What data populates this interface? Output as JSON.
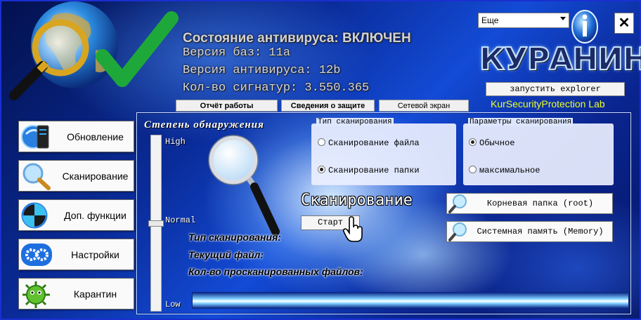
{
  "header": {
    "status_label": "Состояние антивируса:",
    "status_value": "ВКЛЮЧЕН",
    "db_version": "Версия баз: 11а",
    "av_version": "Версия антивируса: 12b",
    "signature_count": "Кол-во сигнатур: 3.550.365"
  },
  "tabs": [
    {
      "label": "Отчёт работы"
    },
    {
      "label": "Сведения о защите"
    },
    {
      "label": "Сетевой экран"
    }
  ],
  "top_right": {
    "menu_selected": "Еще",
    "close_label": "✕",
    "brand": "КУРАНИН",
    "explorer_button": "запустить explorer",
    "lab_name": "KurSecurityProtection Lab"
  },
  "sidebar": {
    "items": [
      {
        "label": "Обновление",
        "icon": "update-icon"
      },
      {
        "label": "Сканирование",
        "icon": "magnifier-icon"
      },
      {
        "label": "Доп. функции",
        "icon": "extra-functions-icon"
      },
      {
        "label": "Настройки",
        "icon": "gears-icon"
      },
      {
        "label": "Карантин",
        "icon": "virus-icon"
      }
    ]
  },
  "detection": {
    "title": "Степень обнаружения",
    "high": "High",
    "normal": "Normal",
    "low": "Low",
    "level": "Normal"
  },
  "scan_type_group": {
    "title": "Тип сканирования",
    "options": [
      {
        "label": "Сканирование файла",
        "checked": false
      },
      {
        "label": "Сканирование папки",
        "checked": true
      }
    ]
  },
  "scan_params_group": {
    "title": "Параметры сканирования",
    "options": [
      {
        "label": "Обычное",
        "checked": true
      },
      {
        "label": "максимальное",
        "checked": false
      }
    ]
  },
  "scan": {
    "heading": "Сканирование",
    "start_button": "Старт",
    "root_button": "Корневая папка (root)",
    "memory_button": "Системная память (Memory)",
    "scan_type_label": "Тип сканирования:",
    "current_file_label": "Текущий файл:",
    "files_count_label": "Кол-во просканированных файлов:",
    "progress": 1.0
  },
  "colors": {
    "lab_name": "#e9ff2a",
    "status_text": "#d2d2d2"
  }
}
